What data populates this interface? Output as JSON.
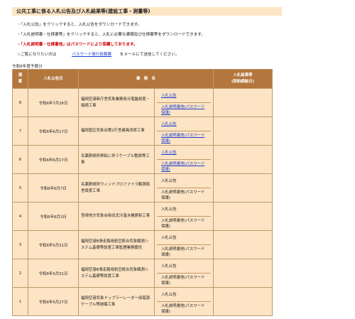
{
  "page": {
    "title": "公共工事に係る入札公告及び入札結果等(建設工事・測量等)"
  },
  "notes": [
    "・「入札公告」をクリックすると、入札公告をダウンロードできます。",
    "・「入札説明書・仕様書等」をクリックすると、入札に必要な書類及び仕様書等をダウンロードできます。",
    "・「入札説明書・仕様書他」はパスワードにより保護しております。"
  ],
  "password_note": {
    "prefix": "☆ご覧になりたい方は",
    "link": "パスワード発行依頼票",
    "suffix": "をメールにて送信してください。"
  },
  "fiscal_year": "令和6年度予算分",
  "table": {
    "headers": {
      "no": "通番",
      "date": "入札公告日",
      "name": "業　務　名",
      "result": "入札結果等\n(契約締結日)"
    },
    "rows": [
      {
        "no": "8",
        "date": "令和6年7月26日",
        "name": "福岡空港新庁舎気象業務用分電盤設置・接続工事",
        "doc1": "入札公告",
        "doc2": "入札説明書他(パスワード保護)",
        "linked": true,
        "result": ""
      },
      {
        "no": "7",
        "date": "令和6年6月17日",
        "name": "福岡管区気象台第2庁舎建具改修工事",
        "doc1": "入札公告",
        "doc2": "入札説明書他(パスワード保護)",
        "linked": true,
        "result": ""
      },
      {
        "no": "6",
        "date": "令和6年6月17日",
        "name": "名瀬測候所移転に伴うケーブル敷設等工事",
        "doc1": "入札公告",
        "doc2": "入札説明書他(パスワード保護)",
        "linked": true,
        "result": ""
      },
      {
        "no": "5",
        "date": "令和6年6月7日",
        "name": "名瀬測候所ウィンドプロファイラ観測局舎設置工事",
        "doc1": "入札公告",
        "doc2": "入札説明書他(パスワード保護)",
        "linked": false,
        "result": ""
      },
      {
        "no": "4",
        "date": "令和6年6月3日",
        "name": "宮崎地方気象台吸収式冷温水機更新工事",
        "doc1": "入札公告",
        "doc2": "入札説明書他(パスワード保護)",
        "linked": false,
        "result": ""
      },
      {
        "no": "3",
        "date": "令和6年5月31日",
        "name": "福岡空港B滑走路用航空統合気象観測システム基礎等設置工事監理業務委託",
        "doc1": "入札公告",
        "doc2": "入札説明書他(パスワード保護)",
        "linked": false,
        "result": ""
      },
      {
        "no": "2",
        "date": "令和6年5月31日",
        "name": "福岡空港B滑走路用航空統合気象観測システム基礎等設置工事",
        "doc1": "入札公告",
        "doc2": "入札説明書他(パスワード保護)",
        "linked": false,
        "result": ""
      },
      {
        "no": "1",
        "date": "令和6年5月27日",
        "name": "福岡空港気象ドップラーレーダー用電源ケーブル等損傷工事",
        "doc1": "入札公告",
        "doc2": "入札説明書他(パスワード保護)",
        "linked": false,
        "result": ""
      }
    ]
  }
}
